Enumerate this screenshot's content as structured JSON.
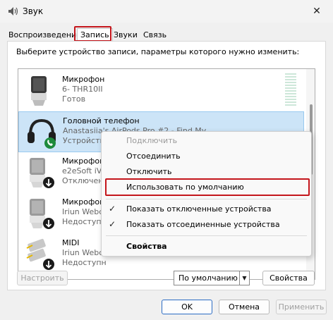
{
  "window": {
    "title": "Звук",
    "close_icon": "close-icon"
  },
  "tabs": [
    {
      "label": "Воспроизведение"
    },
    {
      "label": "Запись",
      "active": true
    },
    {
      "label": "Звуки"
    },
    {
      "label": "Связь"
    }
  ],
  "panel": {
    "instruction": "Выберите устройство записи, параметры которого нужно изменить:"
  },
  "devices": [
    {
      "name": "Микрофон",
      "desc": "6- THR10II",
      "status": "Готов",
      "icon": "microphone-icon",
      "badge": ""
    },
    {
      "name": "Головной телефон",
      "desc": "Anastasiia's AirPods Pro #2 - Find My",
      "status": "Устройство",
      "icon": "headset-icon",
      "badge": "phone-badge-icon"
    },
    {
      "name": "Микрофон",
      "desc": "e2eSoft iV",
      "status": "Отключено",
      "icon": "microphone-icon",
      "badge": "disabled-arrow-badge-icon"
    },
    {
      "name": "Микрофон",
      "desc": "Iriun Webc",
      "status": "Недоступн",
      "icon": "microphone-icon",
      "badge": "disabled-arrow-badge-icon"
    },
    {
      "name": "MIDI",
      "desc": "Iriun Webc",
      "status": "Недоступн",
      "icon": "midi-cable-icon",
      "badge": "disabled-arrow-badge-icon"
    }
  ],
  "context_menu": {
    "items": [
      {
        "label": "Подключить",
        "disabled": true
      },
      {
        "label": "Отсоединить"
      },
      {
        "label": "Отключить"
      },
      {
        "label": "Использовать по умолчанию"
      },
      {
        "label": "Показать отключенные устройства",
        "checked": true
      },
      {
        "label": "Показать отсоединенные устройства",
        "checked": true
      },
      {
        "label": "Свойства",
        "bold": true
      }
    ],
    "check_glyph": "✓"
  },
  "panel_buttons": {
    "configure": "Настроить",
    "default_select": "По умолчанию",
    "properties": "Свойства"
  },
  "dialog_buttons": {
    "ok": "OK",
    "cancel": "Отмена",
    "apply": "Применить"
  },
  "colors": {
    "highlight_red": "#c4161c",
    "selection_bg": "#cce4f7",
    "badge_green": "#1e8a3c"
  }
}
